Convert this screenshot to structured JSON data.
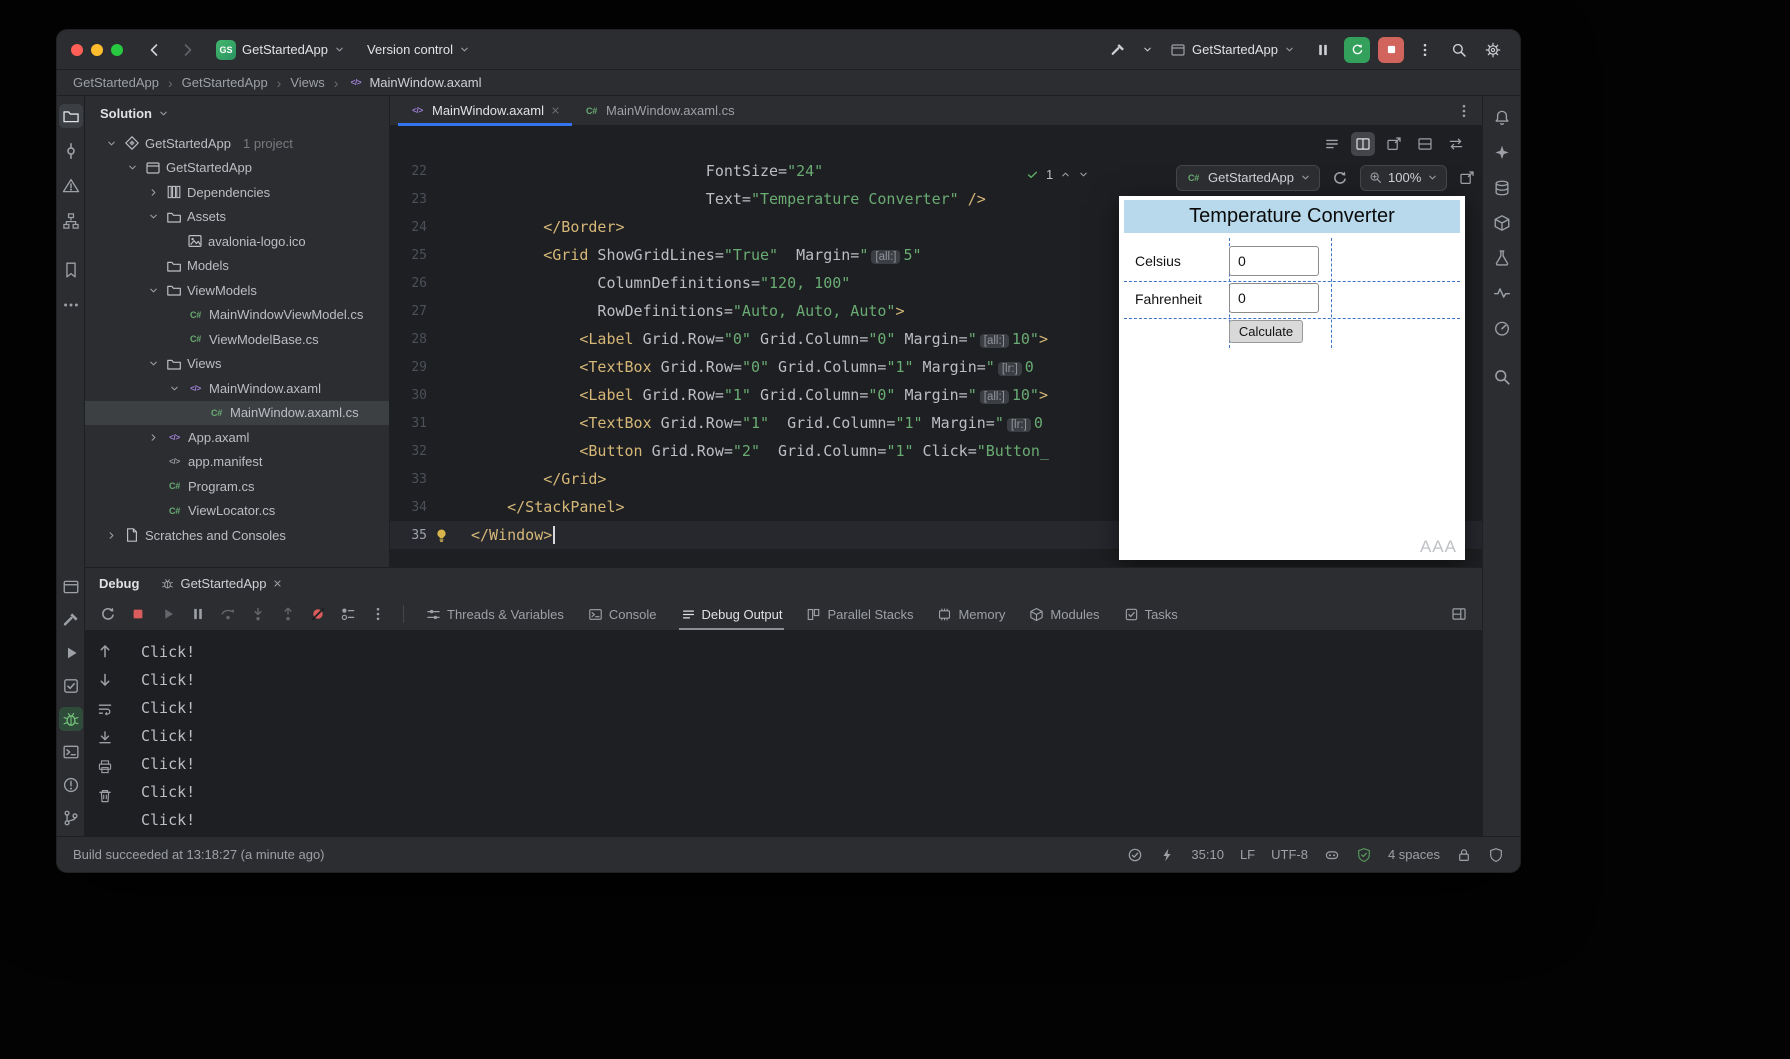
{
  "colors": {
    "accent_blue": "#3574f0",
    "run_green": "#33a05c",
    "stop_red": "#d1655d",
    "error_red": "#db5c5c",
    "string_green": "#6aab73",
    "tag_amber": "#d5b778",
    "app_header_blue": "#b7d9eb"
  },
  "titlebar": {
    "project_badge": "GS",
    "project_name": "GetStartedApp",
    "version_control_label": "Version control",
    "run_config_name": "GetStartedApp",
    "actions": [
      {
        "name": "pause"
      },
      {
        "name": "restart",
        "style": "green"
      },
      {
        "name": "stop",
        "style": "red"
      },
      {
        "name": "more-actions"
      },
      {
        "name": "search-everywhere"
      },
      {
        "name": "settings"
      }
    ]
  },
  "breadcrumbs": {
    "separator": "›",
    "items": [
      "GetStartedApp",
      "GetStartedApp",
      "Views",
      "MainWindow.axaml"
    ]
  },
  "left_strip": {
    "top": [
      {
        "name": "project",
        "active": true
      },
      {
        "name": "commit"
      },
      {
        "name": "errors"
      },
      {
        "name": "structure"
      },
      {
        "name": "bookmarks"
      },
      {
        "name": "more"
      }
    ],
    "bottom": [
      {
        "name": "services"
      },
      {
        "name": "build"
      },
      {
        "name": "run"
      },
      {
        "name": "todo"
      },
      {
        "name": "debug",
        "active": true
      },
      {
        "name": "terminal"
      },
      {
        "name": "problems"
      },
      {
        "name": "vcs"
      }
    ]
  },
  "right_strip": [
    {
      "name": "notifications"
    },
    {
      "name": "ai-assistant"
    },
    {
      "name": "database"
    },
    {
      "name": "nuget"
    },
    {
      "name": "unit-tests"
    },
    {
      "name": "code-analysis"
    },
    {
      "name": "profiler"
    },
    {
      "name": "find"
    }
  ],
  "solution": {
    "header": "Solution",
    "items": [
      {
        "label": "GetStartedApp",
        "suffix": "1 project",
        "depth": 0,
        "icon": "solution",
        "chevron": "down"
      },
      {
        "label": "GetStartedApp",
        "depth": 1,
        "icon": "project",
        "chevron": "down"
      },
      {
        "label": "Dependencies",
        "depth": 2,
        "icon": "dependencies",
        "chevron": "right"
      },
      {
        "label": "Assets",
        "depth": 2,
        "icon": "folder",
        "chevron": "down"
      },
      {
        "label": "avalonia-logo.ico",
        "depth": 3,
        "icon": "image"
      },
      {
        "label": "Models",
        "depth": 2,
        "icon": "folder"
      },
      {
        "label": "ViewModels",
        "depth": 2,
        "icon": "folder",
        "chevron": "down"
      },
      {
        "label": "MainWindowViewModel.cs",
        "depth": 3,
        "icon": "csharp"
      },
      {
        "label": "ViewModelBase.cs",
        "depth": 3,
        "icon": "csharp"
      },
      {
        "label": "Views",
        "depth": 2,
        "icon": "folder",
        "chevron": "down"
      },
      {
        "label": "MainWindow.axaml",
        "depth": 3,
        "icon": "axaml",
        "chevron": "down"
      },
      {
        "label": "MainWindow.axaml.cs",
        "depth": 4,
        "icon": "csharp",
        "selected": true
      },
      {
        "label": "App.axaml",
        "depth": 2,
        "icon": "axaml",
        "chevron": "right"
      },
      {
        "label": "app.manifest",
        "depth": 2,
        "icon": "manifest"
      },
      {
        "label": "Program.cs",
        "depth": 2,
        "icon": "csharp"
      },
      {
        "label": "ViewLocator.cs",
        "depth": 2,
        "icon": "csharp"
      },
      {
        "label": "Scratches and Consoles",
        "depth": 0,
        "icon": "scratches",
        "chevron": "right"
      }
    ]
  },
  "editor": {
    "tabs": [
      {
        "label": "MainWindow.axaml",
        "icon": "axaml",
        "active": true,
        "close": true
      },
      {
        "label": "MainWindow.axaml.cs",
        "icon": "csharp",
        "active": false,
        "close": false
      }
    ],
    "toolbar": [
      {
        "name": "structure-view"
      },
      {
        "name": "split-preview",
        "selected": true
      },
      {
        "name": "open-in-window"
      },
      {
        "name": "split-bottom"
      },
      {
        "name": "sync-view"
      }
    ],
    "inspections": {
      "count": "1"
    },
    "code_lines": [
      {
        "n": "22",
        "seg": [
          [
            "                          FontSize=",
            "p"
          ],
          [
            "\"24\"",
            "s"
          ]
        ]
      },
      {
        "n": "23",
        "seg": [
          [
            "                          Text=",
            "p"
          ],
          [
            "\"Temperature Converter\"",
            "s"
          ],
          [
            " />",
            "t"
          ]
        ]
      },
      {
        "n": "24",
        "seg": [
          [
            "        ",
            "p"
          ],
          [
            "</Border>",
            "t"
          ]
        ]
      },
      {
        "n": "25",
        "seg": [
          [
            "        ",
            "p"
          ],
          [
            "<Grid",
            "t"
          ],
          [
            " ShowGridLines=",
            "p"
          ],
          [
            "\"True\"",
            "s"
          ],
          [
            "  Margin=",
            "p"
          ],
          [
            "\"",
            "s"
          ],
          [
            "[all:]",
            "h"
          ],
          [
            "5\"",
            "s"
          ]
        ]
      },
      {
        "n": "26",
        "seg": [
          [
            "              ColumnDefinitions=",
            "p"
          ],
          [
            "\"120, 100\"",
            "s"
          ]
        ]
      },
      {
        "n": "27",
        "seg": [
          [
            "              RowDefinitions=",
            "p"
          ],
          [
            "\"Auto, Auto, Auto\"",
            "s"
          ],
          [
            ">",
            "t"
          ]
        ]
      },
      {
        "n": "28",
        "seg": [
          [
            "            ",
            "p"
          ],
          [
            "<Label",
            "t"
          ],
          [
            " Grid.Row=",
            "p"
          ],
          [
            "\"0\"",
            "s"
          ],
          [
            " Grid.Column=",
            "p"
          ],
          [
            "\"0\"",
            "s"
          ],
          [
            " Margin=",
            "p"
          ],
          [
            "\"",
            "s"
          ],
          [
            "[all:]",
            "h"
          ],
          [
            "10\"",
            "s"
          ],
          [
            ">",
            "t"
          ]
        ]
      },
      {
        "n": "29",
        "seg": [
          [
            "            ",
            "p"
          ],
          [
            "<TextBox",
            "t"
          ],
          [
            " Grid.Row=",
            "p"
          ],
          [
            "\"0\"",
            "s"
          ],
          [
            " Grid.Column=",
            "p"
          ],
          [
            "\"1\"",
            "s"
          ],
          [
            " Margin=",
            "p"
          ],
          [
            "\"",
            "s"
          ],
          [
            "[lr:]",
            "h"
          ],
          [
            "0",
            "s"
          ]
        ]
      },
      {
        "n": "30",
        "seg": [
          [
            "            ",
            "p"
          ],
          [
            "<Label",
            "t"
          ],
          [
            " Grid.Row=",
            "p"
          ],
          [
            "\"1\"",
            "s"
          ],
          [
            " Grid.Column=",
            "p"
          ],
          [
            "\"0\"",
            "s"
          ],
          [
            " Margin=",
            "p"
          ],
          [
            "\"",
            "s"
          ],
          [
            "[all:]",
            "h"
          ],
          [
            "10\"",
            "s"
          ],
          [
            ">",
            "t"
          ]
        ]
      },
      {
        "n": "31",
        "seg": [
          [
            "            ",
            "p"
          ],
          [
            "<TextBox",
            "t"
          ],
          [
            " Grid.Row=",
            "p"
          ],
          [
            "\"1\"",
            "s"
          ],
          [
            "  Grid.Column=",
            "p"
          ],
          [
            "\"1\"",
            "s"
          ],
          [
            " Margin=",
            "p"
          ],
          [
            "\"",
            "s"
          ],
          [
            "[lr:]",
            "h"
          ],
          [
            "0",
            "s"
          ]
        ]
      },
      {
        "n": "32",
        "seg": [
          [
            "            ",
            "p"
          ],
          [
            "<Button",
            "t"
          ],
          [
            " Grid.Row=",
            "p"
          ],
          [
            "\"2\"",
            "s"
          ],
          [
            "  Grid.Column=",
            "p"
          ],
          [
            "\"1\"",
            "s"
          ],
          [
            " Click=",
            "p"
          ],
          [
            "\"Button_",
            "s"
          ]
        ]
      },
      {
        "n": "33",
        "seg": [
          [
            "        ",
            "p"
          ],
          [
            "</Grid>",
            "t"
          ]
        ]
      },
      {
        "n": "34",
        "seg": [
          [
            "    ",
            "p"
          ],
          [
            "</StackPanel>",
            "t"
          ]
        ]
      },
      {
        "n": "35",
        "seg": [
          [
            "</Window>",
            "t"
          ]
        ],
        "bulb": true,
        "caret": true,
        "current": true
      }
    ]
  },
  "previewer": {
    "config_name": "GetStartedApp",
    "zoom": "100%",
    "app": {
      "title": "Temperature Converter",
      "row1_label": "Celsius",
      "row1_value": "0",
      "row2_label": "Fahrenheit",
      "row2_value": "0",
      "button_label": "Calculate",
      "watermark": "AAA"
    }
  },
  "debug": {
    "window_title": "Debug",
    "session_tab": "GetStartedApp",
    "toolbar": [
      "rerun",
      "stop",
      "resume",
      "pause",
      "step-over",
      "step-into",
      "step-out",
      "mute-breakpoints",
      "view-breakpoints",
      "more-actions"
    ],
    "tabs": [
      {
        "label": "Threads & Variables",
        "icon": "threads"
      },
      {
        "label": "Console",
        "icon": "console"
      },
      {
        "label": "Debug Output",
        "icon": "output",
        "selected": true
      },
      {
        "label": "Parallel Stacks",
        "icon": "stacks"
      },
      {
        "label": "Memory",
        "icon": "memory"
      },
      {
        "label": "Modules",
        "icon": "modules"
      },
      {
        "label": "Tasks",
        "icon": "tasks"
      }
    ],
    "gutter": [
      "nav-up",
      "nav-down",
      "soft-wrap",
      "scroll-end",
      "print",
      "clear"
    ],
    "output": [
      "Click!",
      "Click!",
      "Click!",
      "Click!",
      "Click!",
      "Click!",
      "Click!"
    ]
  },
  "status_bar": {
    "message": "Build succeeded at 13:18:27 (a minute ago)",
    "items": [
      {
        "icon": "check-circle"
      },
      {
        "icon": "attach-debugger"
      },
      {
        "text": "35:10",
        "name": "caret-position"
      },
      {
        "text": "LF",
        "name": "line-separator"
      },
      {
        "text": "UTF-8",
        "name": "file-encoding"
      },
      {
        "icon": "copilot"
      },
      {
        "icon": "shield-green"
      },
      {
        "text": "4 spaces",
        "name": "indent-style"
      },
      {
        "icon": "lock"
      },
      {
        "icon": "shield"
      }
    ]
  }
}
